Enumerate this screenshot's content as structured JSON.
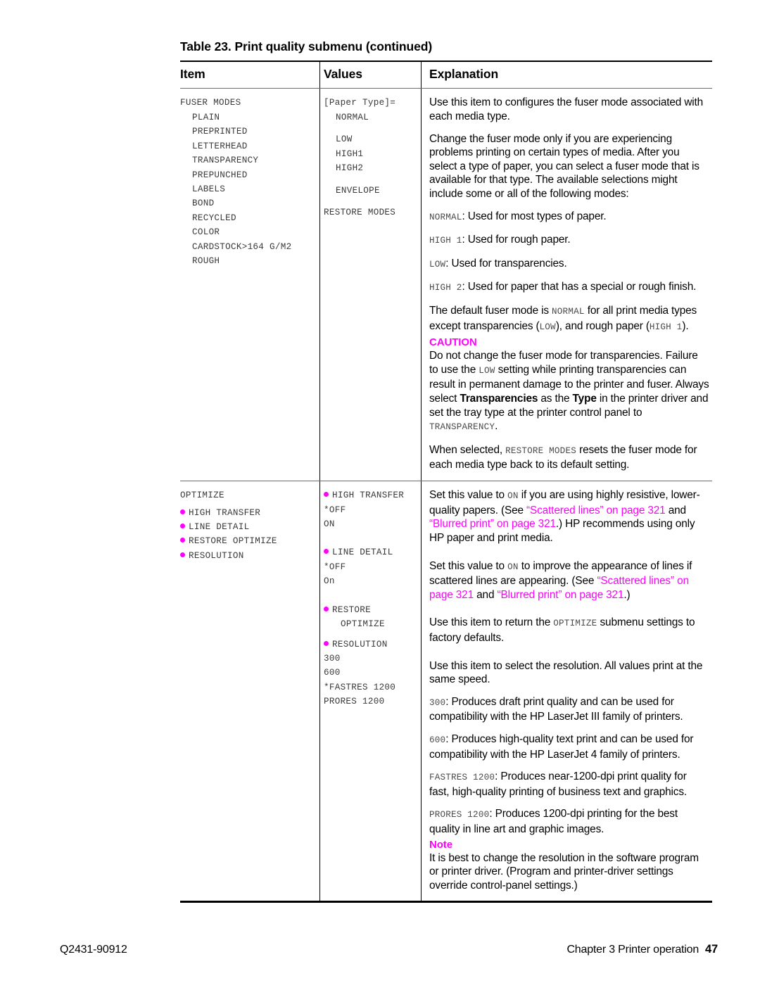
{
  "caption": "Table 23. Print quality submenu (continued)",
  "headers": {
    "item": "Item",
    "values": "Values",
    "explanation": "Explanation"
  },
  "rows": [
    {
      "item_title": "FUSER MODES",
      "item_list": [
        "PLAIN",
        "PREPRINTED",
        "LETTERHEAD",
        "TRANSPARENCY",
        "PREPUNCHED",
        "LABELS",
        "BOND",
        "RECYCLED",
        "COLOR",
        "CARDSTOCK>164 G/M2",
        "ROUGH"
      ],
      "values_title": "[Paper Type]=",
      "values_group1": [
        "NORMAL"
      ],
      "values_group2": [
        "LOW",
        "HIGH1",
        "HIGH2"
      ],
      "values_group3": [
        "ENVELOPE"
      ],
      "values_tail": "RESTORE MODES",
      "explanation": {
        "p1": "Use this item to configures the fuser mode associated with each media type.",
        "p2": "Change the fuser mode only if you are experiencing problems printing on certain types of media. After you select a type of paper, you can select a fuser mode that is available for that type. The available selections might include some or all of the following modes:",
        "mode_normal_code": "NORMAL",
        "mode_normal_text": ": Used for most types of paper.",
        "mode_high1_code": "HIGH 1",
        "mode_high1_text": ": Used for rough paper.",
        "mode_low_code": "LOW",
        "mode_low_text": ": Used for transparencies.",
        "mode_high2_code": "HIGH 2",
        "mode_high2_text": ": Used for paper that has a special or rough finish.",
        "default_a": "The default fuser mode is ",
        "default_code1": "NORMAL",
        "default_b": " for all print media types except transparencies (",
        "default_code2": "LOW",
        "default_c": "), and rough paper (",
        "default_code3": "HIGH 1",
        "default_d": ").",
        "caution_label": "CAUTION",
        "caution_a": "Do not change the fuser mode for transparencies. Failure to use the ",
        "caution_code1": "LOW",
        "caution_b": " setting while printing transparencies can result in permanent damage to the printer and fuser. Always select ",
        "caution_bold1": "Transparencies",
        "caution_c": " as the ",
        "caution_bold2": "Type",
        "caution_d": " in the printer driver and set the tray type at the printer control panel to ",
        "caution_code2": "TRANSPARENCY",
        "caution_e": ".",
        "restore_a": "When selected, ",
        "restore_code": "RESTORE MODES",
        "restore_b": " resets the fuser mode for each media type back to its default setting."
      }
    },
    {
      "item_title": "OPTIMIZE",
      "item_bullets": [
        "HIGH TRANSFER",
        "LINE DETAIL",
        "RESTORE OPTIMIZE",
        "RESOLUTION"
      ],
      "values_blocks": [
        {
          "bullet": "HIGH TRANSFER",
          "options": [
            "*OFF",
            "ON"
          ]
        },
        {
          "bullet": "LINE DETAIL",
          "options": [
            "*OFF",
            "On"
          ]
        },
        {
          "bullet": "RESTORE",
          "continuation": "OPTIMIZE",
          "options": []
        },
        {
          "bullet": "RESOLUTION",
          "options": [
            "300",
            "600",
            "*FASTRES 1200",
            "PRORES 1200"
          ]
        }
      ],
      "explanation": {
        "high_transfer_a": "Set this value to ",
        "high_transfer_code": "ON",
        "high_transfer_b": " if you are using highly resistive, lower-quality papers. (See ",
        "high_transfer_link1": "“Scattered lines” on page 321",
        "high_transfer_c": " and ",
        "high_transfer_link2": "“Blurred print” on page 321",
        "high_transfer_d": ".) HP recommends using only HP paper and print media.",
        "line_detail_a": "Set this value to ",
        "line_detail_code": "ON",
        "line_detail_b": " to improve the appearance of lines if scattered lines are appearing. (See ",
        "line_detail_link1": "“Scattered lines” on page 321",
        "line_detail_c": " and ",
        "line_detail_link2": "“Blurred print” on page 321",
        "line_detail_d": ".)",
        "restore_a": "Use this item to return the ",
        "restore_code": "OPTIMIZE",
        "restore_b": " submenu settings to factory defaults.",
        "resolution_p": "Use this item to select the resolution. All values print at the same speed.",
        "res300_code": "300",
        "res300_text": ": Produces draft print quality and can be used for compatibility with the HP LaserJet III family of printers.",
        "res600_code": "600",
        "res600_text": ": Produces high-quality text print and can be used for compatibility with the HP LaserJet 4 family of printers.",
        "fastres_code": "FASTRES 1200",
        "fastres_text": ": Produces near-1200-dpi print quality for fast, high-quality printing of business text and graphics.",
        "prores_code": "PRORES 1200",
        "prores_text": ": Produces 1200-dpi printing for the best quality in line art and graphic images.",
        "note_label": "Note",
        "note_text": "It is best to change the resolution in the software program or printer driver. (Program and printer-driver settings override control-panel settings.)"
      }
    }
  ],
  "footer": {
    "part_number": "Q2431-90912",
    "chapter": "Chapter 3 Printer operation",
    "page_number": "47"
  },
  "colors": {
    "accent_magenta": "#ff00ff",
    "rule_black": "#000000",
    "rule_gray": "#6b6b6b",
    "mono_gray": "#3a3a3a"
  }
}
